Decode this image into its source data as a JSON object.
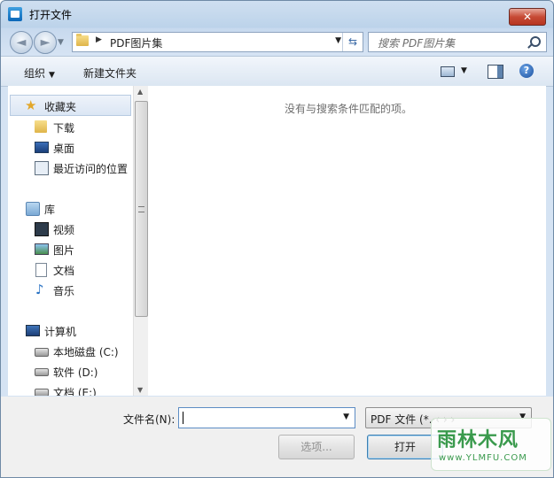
{
  "window": {
    "title": "打开文件",
    "close_label": "✕"
  },
  "nav": {
    "back_glyph": "◄",
    "forward_glyph": "►",
    "recent_drop_glyph": "▼",
    "breadcrumb_arrow": "▶",
    "breadcrumb": "PDF图片集",
    "address_drop_glyph": "▼",
    "refresh_glyph": "⇆",
    "search_placeholder": "搜索 PDF图片集"
  },
  "toolbar": {
    "organize_label": "组织",
    "organize_caret": "▼",
    "new_folder_label": "新建文件夹",
    "view_drop_glyph": "▼",
    "help_glyph": "?"
  },
  "sidebar": {
    "items": [
      {
        "label": "收藏夹",
        "icon": "star-icon"
      },
      {
        "label": "下载",
        "icon": "download-folder-icon"
      },
      {
        "label": "桌面",
        "icon": "desktop-icon"
      },
      {
        "label": "最近访问的位置",
        "icon": "recent-places-icon"
      },
      {
        "label": "库",
        "icon": "library-icon"
      },
      {
        "label": "视频",
        "icon": "video-icon"
      },
      {
        "label": "图片",
        "icon": "pictures-icon"
      },
      {
        "label": "文档",
        "icon": "documents-icon"
      },
      {
        "label": "音乐",
        "icon": "music-icon"
      },
      {
        "label": "计算机",
        "icon": "computer-icon"
      },
      {
        "label": "本地磁盘 (C:)",
        "icon": "system-drive-icon"
      },
      {
        "label": "软件 (D:)",
        "icon": "drive-icon"
      },
      {
        "label": "文档 (E:)",
        "icon": "drive-icon"
      }
    ],
    "scroll_up_glyph": "▲",
    "scroll_down_glyph": "▼"
  },
  "content": {
    "empty_message": "没有与搜索条件匹配的项。"
  },
  "footer": {
    "filename_label": "文件名(N):",
    "filename_value": "",
    "filename_drop_glyph": "▼",
    "filetype_value": "PDF 文件 (*.·‹ › ›",
    "filetype_drop_glyph": "▼",
    "options_label": "选项...",
    "open_label": "打开"
  },
  "watermark": {
    "text": "雨林木风",
    "url": "www.YLMFU.COM"
  }
}
